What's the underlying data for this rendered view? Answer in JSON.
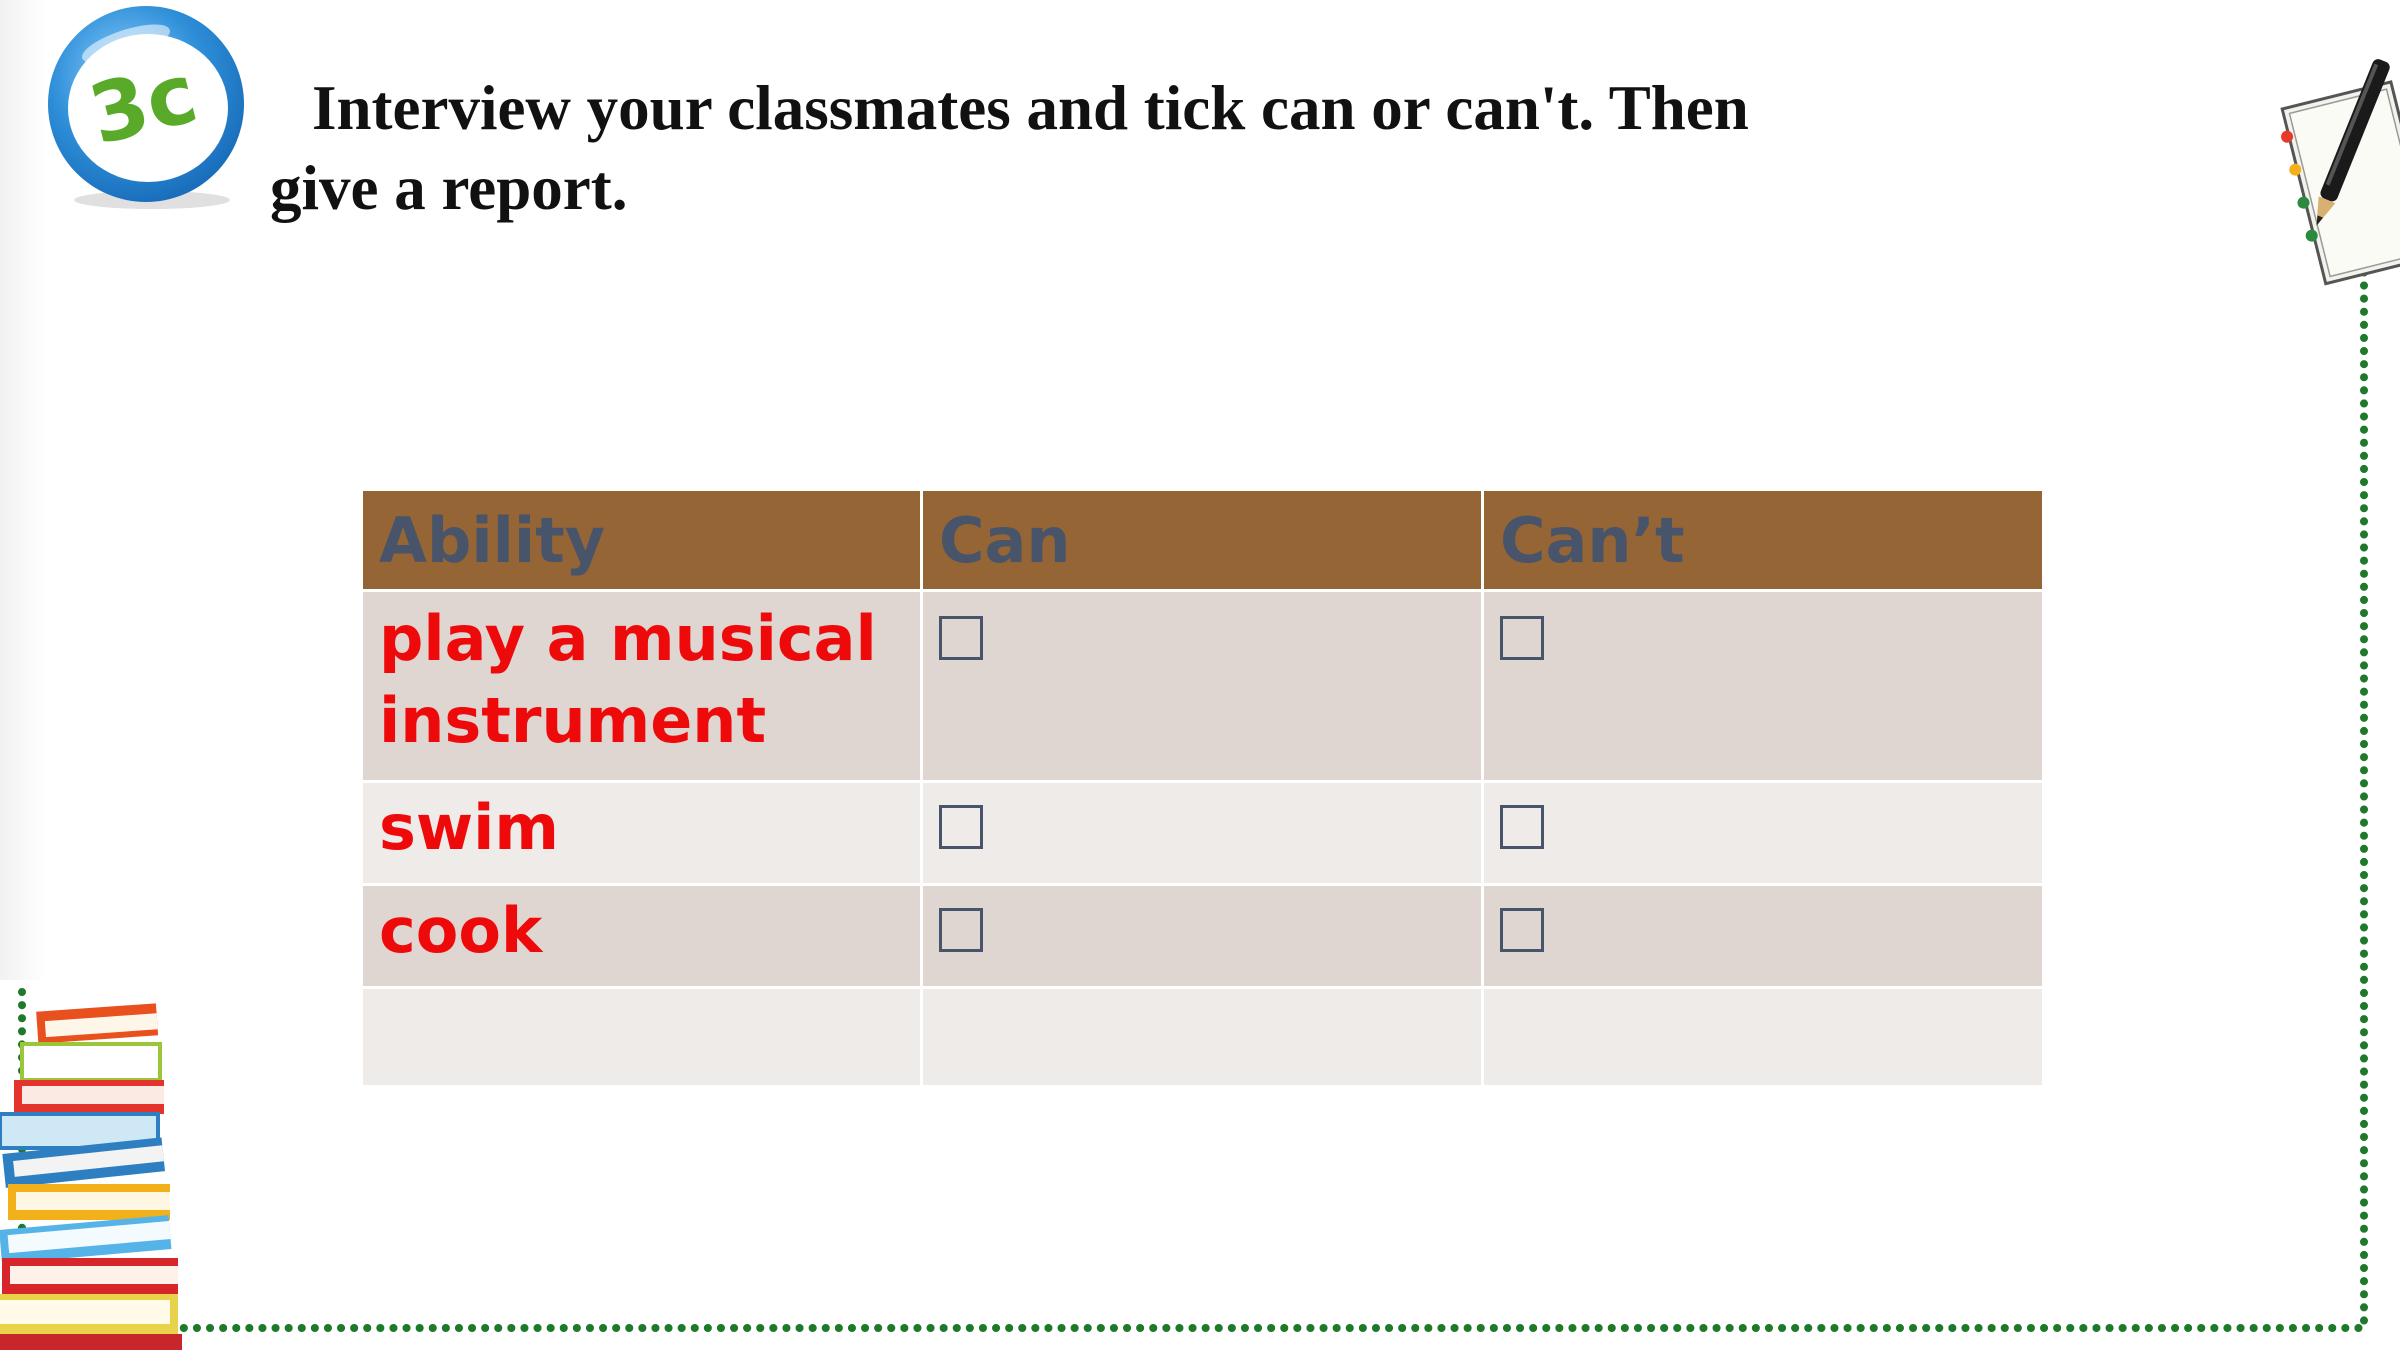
{
  "badge": {
    "label": "3c",
    "colors": {
      "ring": "#2f8fd8",
      "text": "#5aaa2a"
    },
    "icon": "numbered-badge-icon"
  },
  "title": {
    "line1": "Interview your classmates and tick can or can't. Then",
    "line2": "give a report."
  },
  "table": {
    "headers": [
      "Ability",
      "Can",
      "Can’t"
    ],
    "rows": [
      {
        "ability": [
          "play a musical",
          "instrument"
        ],
        "can": "",
        "cant": ""
      },
      {
        "ability": [
          "swim"
        ],
        "can": "",
        "cant": ""
      },
      {
        "ability": [
          "cook"
        ],
        "can": "",
        "cant": ""
      },
      {
        "ability": [
          ""
        ],
        "can": "",
        "cant": ""
      }
    ],
    "checkbox_glyph": "empty-checkbox-icon",
    "colors": {
      "header_bg": "#966535",
      "header_text": "#47546a",
      "row_dark": "#dfd6d1",
      "row_light": "#efebe8",
      "ability_text": "#ee0a0a"
    }
  },
  "decorations": {
    "top_right": "notebook-with-pen-icon",
    "bottom_left": "stack-of-books-icon",
    "frame": "green-dotted-border",
    "frame_color": "#1e7a2a"
  }
}
